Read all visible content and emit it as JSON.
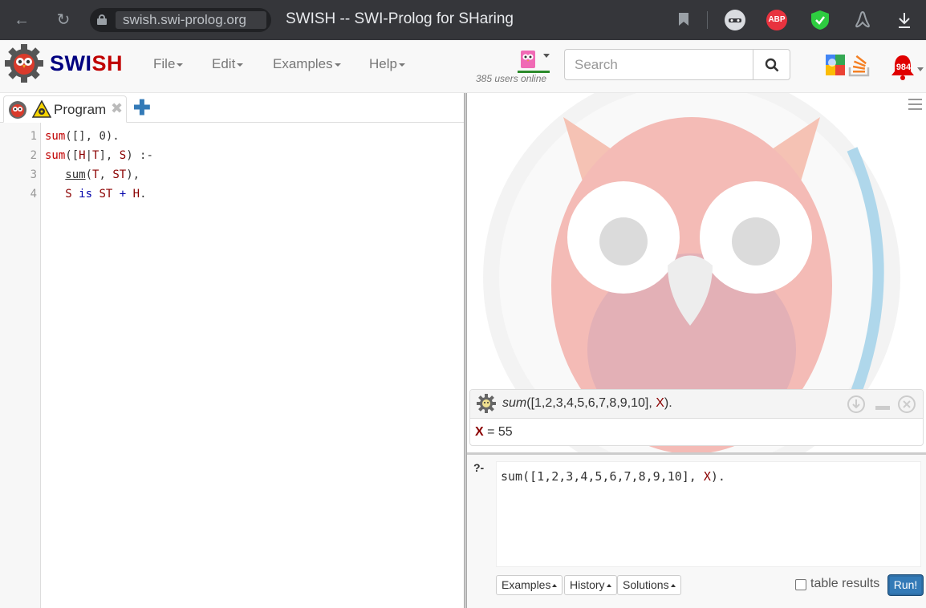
{
  "browser": {
    "url": "swish.swi-prolog.org",
    "page_title": "SWISH -- SWI-Prolog for SHaring",
    "extensions": [
      "abp-icon",
      "shield-icon",
      "incognito-icon",
      "acrobat-icon"
    ],
    "abp_label": "ABP"
  },
  "navbar": {
    "brand_part1": "SWI",
    "brand_part2": "SH",
    "menus": [
      "File",
      "Edit",
      "Examples",
      "Help"
    ],
    "users_online": "385 users online",
    "search_placeholder": "Search",
    "notification_count": "984"
  },
  "editor": {
    "tab_label": "Program",
    "close_glyph": "✖",
    "add_glyph": "✚",
    "line_numbers": [
      "1",
      "2",
      "3",
      "4"
    ]
  },
  "answer": {
    "query_pred": "sum",
    "query_args": "([1,2,3,4,5,6,7,8,9,10], ",
    "query_var": "X",
    "query_end": ").",
    "result_var": "X",
    "result_rest": " = 55"
  },
  "query": {
    "prompt": "?-",
    "code_start": "sum([1,2,3,4,5,6,7,8,9,10], ",
    "code_var": "X",
    "code_end": ").",
    "buttons": [
      "Examples",
      "History",
      "Solutions"
    ],
    "table_results_label": "table results",
    "run_label": "Run!"
  }
}
